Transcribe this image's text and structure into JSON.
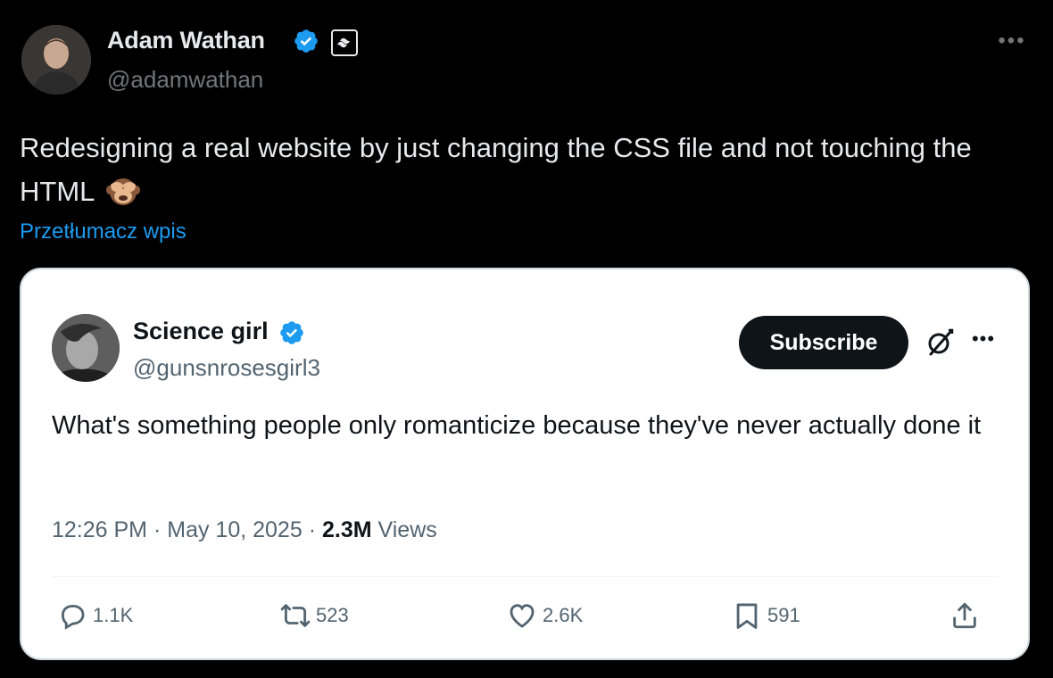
{
  "author": {
    "name": "Adam Wathan",
    "handle": "@adamwathan",
    "verified_icon": "verified-badge-icon",
    "org_icon": "tailwind-logo-icon"
  },
  "tweet": {
    "text": "Redesigning a real website by just changing the CSS file and not touching the HTML",
    "emoji_icon": "see-no-evil-monkey-icon",
    "translate_label": "Przetłumacz wpis"
  },
  "quoted": {
    "name": "Science girl",
    "handle": "@gunsnrosesgirl3",
    "subscribe_label": "Subscribe",
    "text": "What's something people only romanticize because they've never actually done it",
    "time": "12:26 PM",
    "date": "May 10, 2025",
    "views_count": "2.3M",
    "views_label": "Views",
    "separator": "·",
    "actions": {
      "replies": "1.1K",
      "reposts": "523",
      "likes": "2.6K",
      "bookmarks": "591"
    }
  },
  "colors": {
    "background": "#000000",
    "link_blue": "#1d9bf0",
    "verified_blue": "#1d9bf0",
    "card_bg": "#ffffff",
    "primary_text_dark": "#e7e9ea",
    "secondary_text_dark": "#71767b",
    "primary_text_light": "#0f1419",
    "secondary_text_light": "#536471"
  }
}
